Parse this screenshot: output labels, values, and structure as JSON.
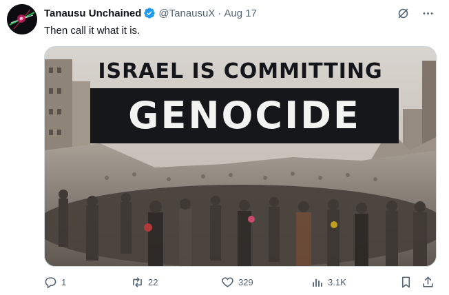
{
  "author": {
    "display_name": "Tanausu Unchained",
    "handle": "@TanausuX",
    "separator": "·",
    "date": "Aug 17",
    "verified_color": "#1d9bf0"
  },
  "tweet": {
    "text": "Then call it what it is."
  },
  "media": {
    "headline_line1": "ISRAEL IS COMMITTING",
    "headline_line2": "GENOCIDE"
  },
  "actions": {
    "replies": "1",
    "reposts": "22",
    "likes": "329",
    "views": "3.1K"
  },
  "icons": {
    "grok": "grok-icon",
    "more": "more-icon",
    "reply": "reply-icon",
    "repost": "repost-icon",
    "like": "heart-icon",
    "views": "views-icon",
    "bookmark": "bookmark-icon",
    "share": "share-icon"
  },
  "colors": {
    "text_primary": "#0f1419",
    "text_secondary": "#536471",
    "border": "#cfd9de"
  }
}
